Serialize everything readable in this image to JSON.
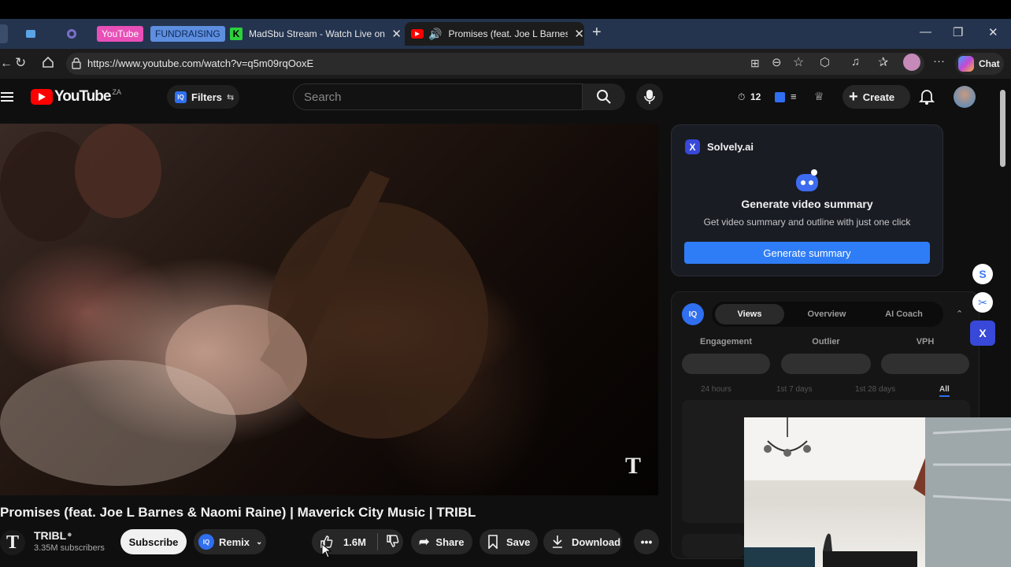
{
  "browser": {
    "tabs": {
      "chip_youtube": "YouTube",
      "chip_fundraising": "FUNDRAISING",
      "madsbu_title": "MadSbu Stream - Watch Live on K",
      "active_title": "Promises (feat. Joe L Barnes &"
    },
    "url": "https://www.youtube.com/watch?v=q5m09rqOoxE",
    "chat_label": "Chat"
  },
  "youtube": {
    "logo_text": "YouTube",
    "region": "ZA",
    "filters_label": "Filters",
    "search_placeholder": "Search",
    "timer_count": "12",
    "create_label": "Create",
    "video_title": "Promises (feat. Joe L Barnes & Naomi Raine) | Maverick City Music | TRIBL",
    "channel_name": "TRIBL",
    "subscribers": "3.35M subscribers",
    "subscribe_label": "Subscribe",
    "remix_label": "Remix",
    "like_count": "1.6M",
    "share_label": "Share",
    "save_label": "Save",
    "download_label": "Download",
    "watermark": "T"
  },
  "solvely": {
    "brand": "Solvely.ai",
    "heading": "Generate video summary",
    "subtext": "Get video summary and outline with just one click",
    "button": "Generate summary"
  },
  "iq_panel": {
    "badge": "IQ",
    "tabs": [
      "Views",
      "Overview",
      "AI Coach"
    ],
    "metrics": [
      "Engagement",
      "Outlier",
      "VPH"
    ],
    "ranges": [
      "24 hours",
      "1st 7 days",
      "1st 28 days",
      "All"
    ]
  },
  "side_buttons": [
    "S",
    "✂",
    "X"
  ],
  "colors": {
    "youtube_red": "#ff0000",
    "solvely_blue": "#2f7df6",
    "tab_strip": "#24344f",
    "chip_youtube_bg": "#e84fb7",
    "chip_fundraising_bg": "#5d8ee0"
  }
}
